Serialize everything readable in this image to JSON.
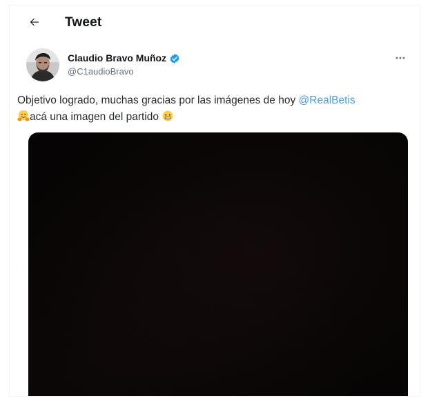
{
  "header": {
    "back_icon": "arrow-left-icon",
    "title": "Tweet"
  },
  "author": {
    "display_name": "Claudio Bravo Muñoz",
    "handle": "@C1audioBravo",
    "verified": true,
    "verified_color": "#1d9bf0",
    "more_icon": "more-horizontal-icon"
  },
  "tweet": {
    "line1_text": "Objetivo logrado, muchas gracias por las imágenes de hoy ",
    "mention": "@RealBetis",
    "line2_emoji": "hugging-face-emoji",
    "line2_text": "acá una imagen del partido ",
    "line2_end_emoji": "grimacing-smile-emoji"
  },
  "media": {
    "background_color": "#060404"
  },
  "colors": {
    "text": "#0f1419",
    "muted": "#66707a",
    "link": "#4a9de4",
    "background": "#ffffff"
  }
}
